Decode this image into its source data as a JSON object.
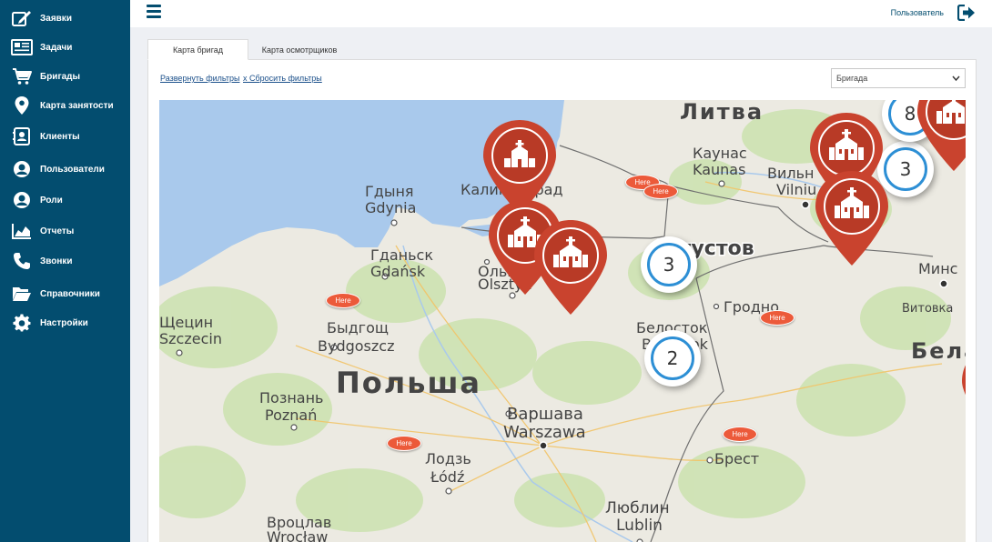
{
  "sidebar": {
    "items": [
      {
        "label": "Заявки",
        "icon": "edit-icon"
      },
      {
        "label": "Задачи",
        "icon": "newspaper-icon"
      },
      {
        "label": "Бригады",
        "icon": "cart-icon"
      },
      {
        "label": "Карта занятости",
        "icon": "map-marker-icon"
      },
      {
        "label": "Клиенты",
        "icon": "contact-card-icon"
      },
      {
        "label": "Пользователи",
        "icon": "user-circle-icon"
      },
      {
        "label": "Роли",
        "icon": "user-role-icon"
      },
      {
        "label": "Отчеты",
        "icon": "area-chart-icon"
      },
      {
        "label": "Звонки",
        "icon": "phone-icon"
      },
      {
        "label": "Справочники",
        "icon": "folder-open-icon"
      },
      {
        "label": "Настройки",
        "icon": "gear-icon"
      }
    ]
  },
  "header": {
    "user_label": "Пользователь"
  },
  "tabs": [
    {
      "label": "Карта бригад",
      "active": true
    },
    {
      "label": "Карта осмотрщиков",
      "active": false
    }
  ],
  "filters": {
    "expand_label": "Развернуть фильтры",
    "reset_label": "x Сбросить фильтры",
    "select_value": "Бригада"
  },
  "map": {
    "labels": {
      "litva": "Литва",
      "kaunas_ru": "Каунас",
      "kaunas": "Kaunas",
      "vilnius_ru": "Вильн",
      "vilnius": "Vilniu",
      "kaliningrad": "Калининград",
      "gdynia_ru": "Гдыня",
      "gdynia": "Gdynia",
      "gdansk_ru": "Гданьск",
      "gdansk": "Gdańsk",
      "olsztyn_ru": "Ольштын",
      "olsztyn": "Olsztyn",
      "augustow": "Августов",
      "minsk": "Минс",
      "grodno": "Гродно",
      "vitovka": "Витовка",
      "szczecin_ru": "Щецин",
      "szczecin": "Szczecin",
      "bydgoszcz_ru": "Быдгощ",
      "bydgoszcz": "Bydgoszcz",
      "poland": "Польша",
      "bialystok_ru": "Белосток",
      "bialystok": "Białystok",
      "belarus": "Бела",
      "poznan_ru": "Познань",
      "poznan": "Poznań",
      "warsaw_ru": "Варшава",
      "warsaw": "Warszawa",
      "lodz_ru": "Лодзь",
      "lodz": "Łódź",
      "brest": "Брест",
      "lublin_ru": "Люблин",
      "lublin": "Lublin",
      "wroclaw_ru": "Вроцлав",
      "wroclaw": "Wrocław"
    },
    "here_markers": [
      "Here",
      "Here",
      "Here",
      "Here",
      "Here",
      "Here"
    ],
    "clusters": [
      "3",
      "2",
      "3",
      "8"
    ],
    "colors": {
      "sidebar": "#034d6f",
      "pin": "#c9432e",
      "here": "#ec5a3a",
      "cluster_ring": "#2d8fd5",
      "water": "#a9c9ec"
    }
  }
}
